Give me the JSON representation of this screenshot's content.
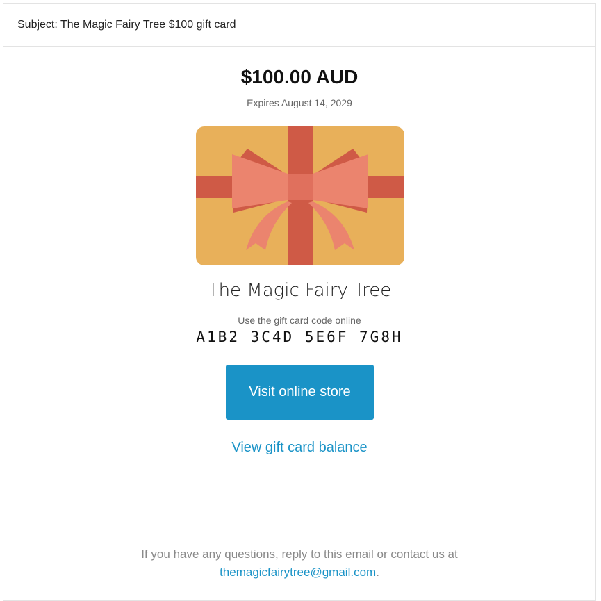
{
  "email": {
    "subject": "Subject: The Magic Fairy Tree $100 gift card"
  },
  "gift_card": {
    "amount": "$100.00 AUD",
    "expires": "Expires August 14, 2029",
    "store_name": "The Magic Fairy Tree",
    "code_label": "Use the gift card code online",
    "code": "A1B2 3C4D 5E6F 7G8H",
    "card_colors": {
      "background": "#E8B05A",
      "ribbon": "#CF5A46",
      "bow": "#EB846E"
    }
  },
  "actions": {
    "visit_store_label": "Visit online store",
    "balance_link_label": "View gift card balance"
  },
  "footer": {
    "text": "If you have any questions, reply to this email or contact us at",
    "email_link": "themagicfairytree@gmail.com",
    "trailing": "."
  }
}
